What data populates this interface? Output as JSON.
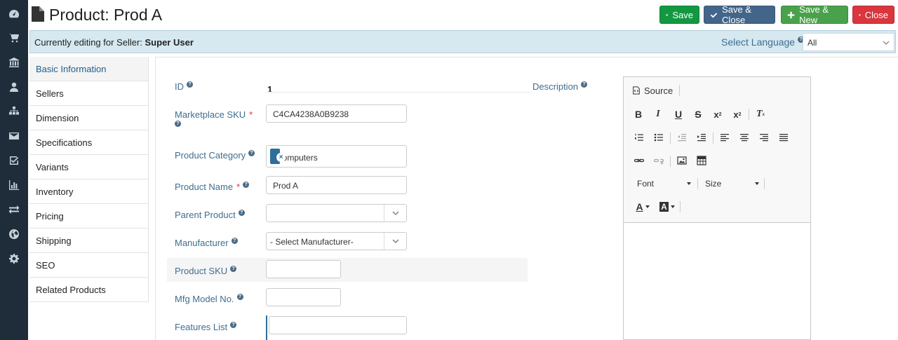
{
  "header": {
    "title": "Product: Prod A",
    "buttons": {
      "save": "Save",
      "save_close": "Save & Close",
      "save_new": "Save & New",
      "close": "Close"
    }
  },
  "seller_bar": {
    "prefix": "Currently editing for Seller: ",
    "seller": "Super User",
    "language_label": "Select Language",
    "language_value": "All"
  },
  "tabs": [
    {
      "label": "Basic Information",
      "active": true
    },
    {
      "label": "Sellers"
    },
    {
      "label": "Dimension"
    },
    {
      "label": "Specifications"
    },
    {
      "label": "Variants"
    },
    {
      "label": "Inventory"
    },
    {
      "label": "Pricing"
    },
    {
      "label": "Shipping"
    },
    {
      "label": "SEO"
    },
    {
      "label": "Related Products"
    }
  ],
  "form": {
    "id_label": "ID",
    "id_value": "1",
    "sku_label": "Marketplace SKU",
    "sku_value": "C4CA4238A0B9238",
    "category_label": "Product Category",
    "category_chip": "Computers",
    "name_label": "Product Name",
    "name_value": "Prod A",
    "parent_label": "Parent Product",
    "parent_value": "",
    "manufacturer_label": "Manufacturer",
    "manufacturer_value": "- Select Manufacturer-",
    "product_sku_label": "Product SKU",
    "mfg_model_label": "Mfg Model No.",
    "features_label": "Features List",
    "description_label": "Description"
  },
  "editor": {
    "source_label": "Source",
    "font_label": "Font",
    "size_label": "Size"
  },
  "colors": {
    "rail": "#1f2d3a",
    "save": "#139842",
    "save_close": "#43658a",
    "save_new": "#49a24b",
    "close": "#d9363d",
    "label": "#3f6e8f",
    "chip": "#2d6e9c"
  }
}
